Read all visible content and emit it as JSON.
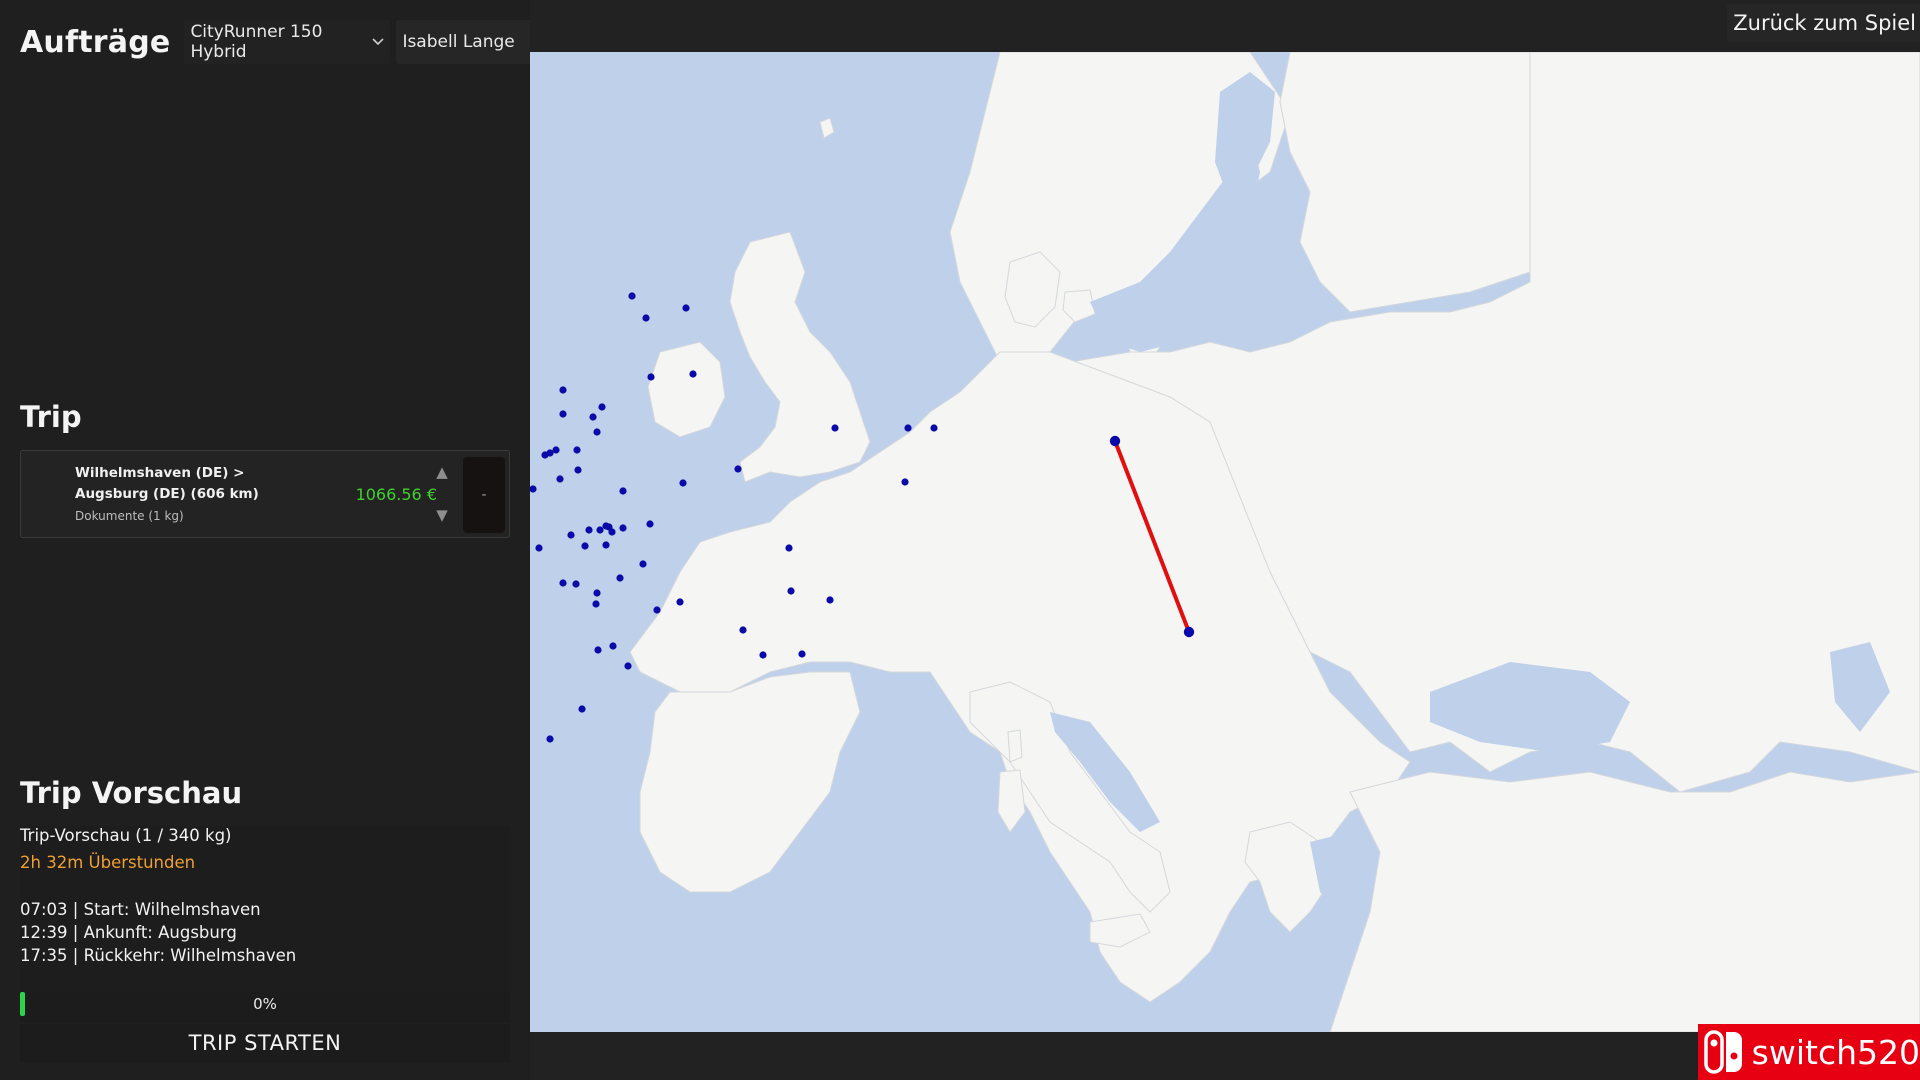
{
  "header": {
    "title": "Aufträge",
    "vehicle_select": "CityRunner 150 Hybrid",
    "driver_select": "Isabell Lange"
  },
  "trip": {
    "section_title": "Trip",
    "item": {
      "route_line1": "Wilhelmshaven (DE) >",
      "route_line2": "Augsburg (DE) (606 km)",
      "cargo": "Dokumente (1 kg)",
      "price": "1066.56 €",
      "remove_label": "-"
    }
  },
  "preview": {
    "section_title": "Trip Vorschau",
    "capacity": "Trip-Vorschau (1 / 340 kg)",
    "overtime": "2h 32m Überstunden",
    "start": "07:03 | Start: Wilhelmshaven",
    "arrival": "12:39 | Ankunft: Augsburg",
    "return": "17:35 | Rückkehr: Wilhelmshaven",
    "progress_percent": 0,
    "progress_label": "0%",
    "start_button": "TRIP STARTEN"
  },
  "map": {
    "back_button": "Zurück zum Spiel",
    "route_color": "#e01010",
    "marker_color": "#0a0aa8",
    "land_color": "#f5f5f3",
    "sea_color": "#bed0ea",
    "route_from": "Wilhelmshaven",
    "route_to": "Augsburg"
  },
  "watermark": {
    "text": "switch520",
    "color": "#e60012"
  },
  "colors": {
    "price": "#3fd12e",
    "overtime": "#f0a030",
    "progress": "#2ed34a"
  }
}
